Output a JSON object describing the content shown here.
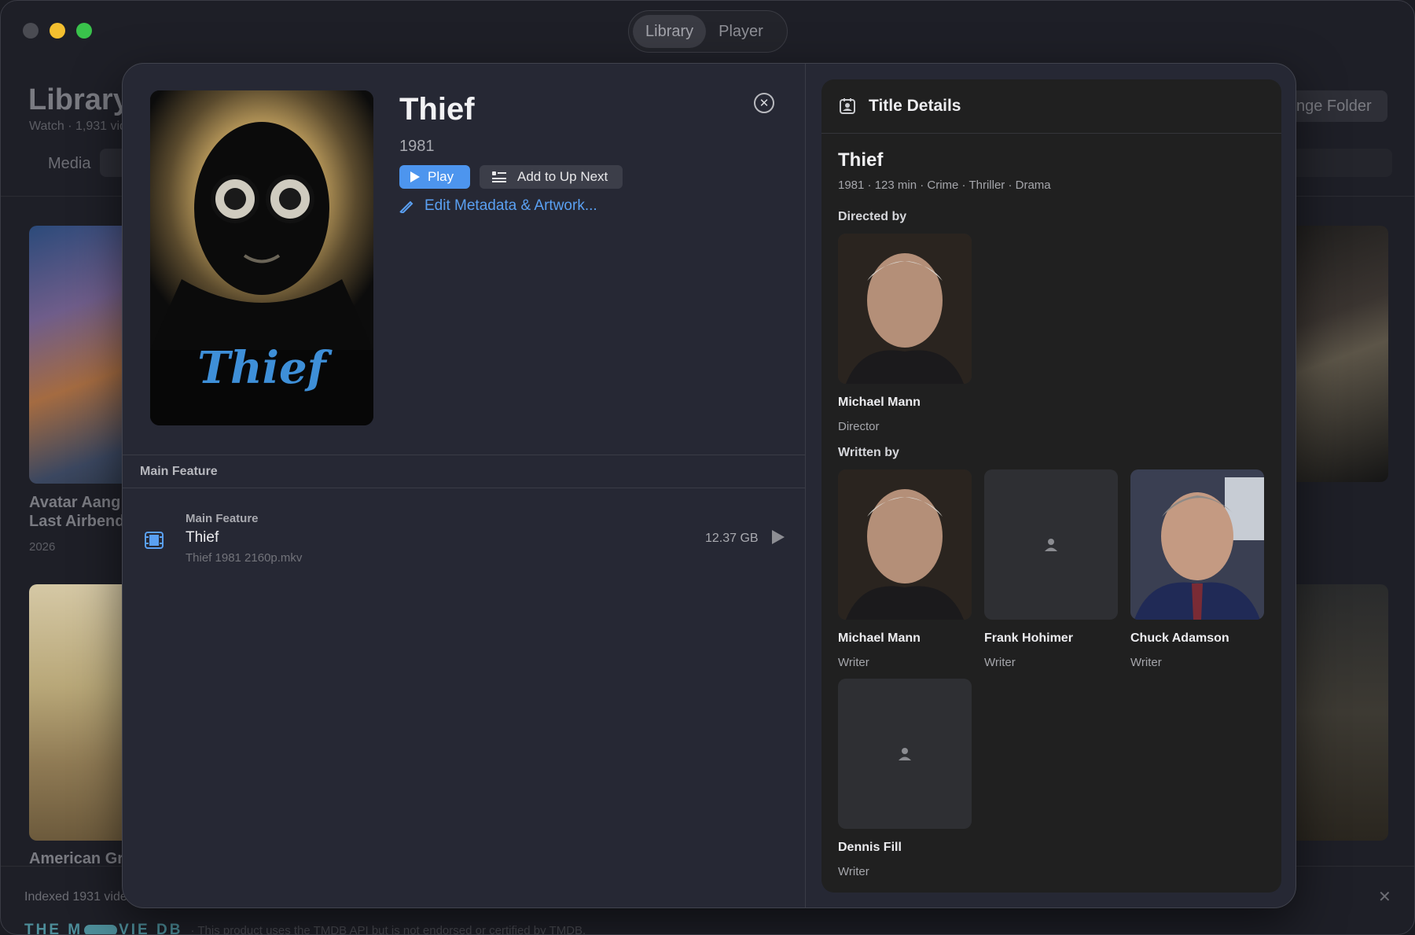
{
  "titlebar": {
    "tabs": [
      {
        "label": "Library",
        "active": true
      },
      {
        "label": "Player",
        "active": false
      }
    ]
  },
  "background": {
    "title": "Library",
    "subtitle": "Watch · 1,931 vid",
    "media_tab": "Media",
    "change_folder": "nge Folder",
    "items": [
      {
        "title": "Avatar Aang Last Airbend",
        "year": "2026"
      },
      {
        "title": "American Gr"
      }
    ],
    "status": "Indexed 1931 vide",
    "tmdb_logo_left": "THE M",
    "tmdb_logo_right": "VIE DB",
    "tmdb_notice": "· This product uses the TMDB API but is not endorsed or certified by TMDB."
  },
  "modal": {
    "title": "Thief",
    "year": "1981",
    "poster_text": "Thief",
    "play_label": "Play",
    "upnext_label": "Add to Up Next",
    "edit_label": "Edit Metadata & Artwork...",
    "section_label": "Main Feature",
    "file": {
      "kicker": "Main Feature",
      "title": "Thief",
      "filename": "Thief 1981 2160p.mkv",
      "size": "12.37 GB"
    }
  },
  "details": {
    "header": "Title Details",
    "title": "Thief",
    "meta": "1981 · 123 min · Crime · Thriller · Drama",
    "directed_by_label": "Directed by",
    "written_by_label": "Written by",
    "director": {
      "name": "Michael Mann",
      "role": "Director"
    },
    "writers": [
      {
        "name": "Michael Mann",
        "role": "Writer"
      },
      {
        "name": "Frank Hohimer",
        "role": "Writer"
      },
      {
        "name": "Chuck Adamson",
        "role": "Writer"
      },
      {
        "name": "Dennis Fill",
        "role": "Writer"
      }
    ]
  },
  "colors": {
    "accent": "#4d95ee",
    "link": "#5aa0f2",
    "modal_bg": "#262834",
    "details_bg": "#202020"
  }
}
